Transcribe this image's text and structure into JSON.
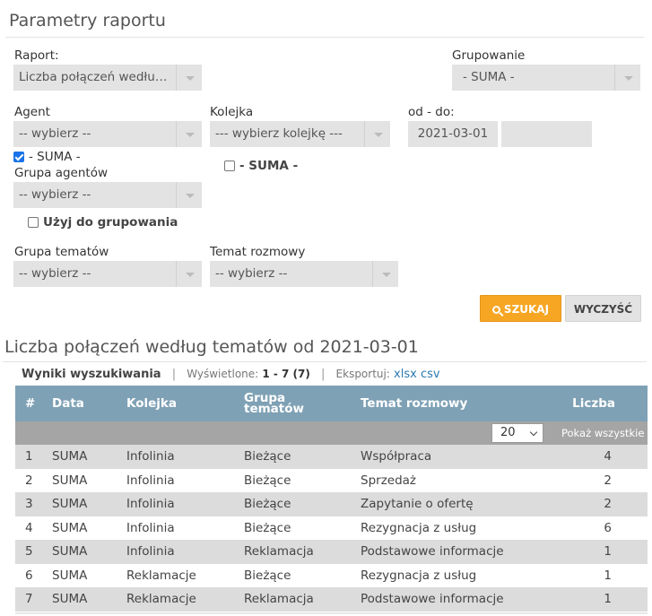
{
  "params": {
    "title": "Parametry raportu",
    "raport_label": "Raport:",
    "raport_value": "Liczba połączeń według tematów",
    "grupowanie_label": "Grupowanie",
    "grupowanie_value": "- SUMA -",
    "agent_label": "Agent",
    "agent_value": "-- wybierz --",
    "kolejka_label": "Kolejka",
    "kolejka_value": "--- wybierz kolejkę ---",
    "od_do_label": "od - do:",
    "date_from": "2021-03-01",
    "date_to": "",
    "agent_suma_label": "- SUMA -",
    "agent_suma_checked": true,
    "kolejka_suma_label": "- SUMA -",
    "kolejka_suma_checked": false,
    "grupa_agentow_label": "Grupa agentów",
    "grupa_agentow_value": "-- wybierz --",
    "uzyj_label": "Użyj do grupowania",
    "uzyj_checked": false,
    "grupa_tematow_label": "Grupa tematów",
    "grupa_tematow_value": "-- wybierz --",
    "temat_label": "Temat rozmowy",
    "temat_value": "-- wybierz --",
    "search_button": "SZUKAJ",
    "clear_button": "WYCZYŚĆ"
  },
  "results": {
    "title": "Liczba połączeń według tematów od 2021-03-01",
    "meta_label": "Wyniki wyszukiwania",
    "displayed_label": "Wyświetlone:",
    "displayed_value": "1 - 7 (7)",
    "export_label": "Eksportuj:",
    "export_xlsx": "xlsx",
    "export_csv": "csv",
    "columns": {
      "num": "#",
      "data": "Data",
      "kolejka": "Kolejka",
      "grupa_line1": "Grupa",
      "grupa_line2": "tematów",
      "temat": "Temat rozmowy",
      "liczba": "Liczba"
    },
    "page_size": "20",
    "show_all": "Pokaż wszystkie",
    "rows": [
      {
        "num": "1",
        "data": "SUMA",
        "kolejka": "Infolinia",
        "grupa": "Bieżące",
        "temat": "Współpraca",
        "liczba": "4"
      },
      {
        "num": "2",
        "data": "SUMA",
        "kolejka": "Infolinia",
        "grupa": "Bieżące",
        "temat": "Sprzedaż",
        "liczba": "2"
      },
      {
        "num": "3",
        "data": "SUMA",
        "kolejka": "Infolinia",
        "grupa": "Bieżące",
        "temat": "Zapytanie o ofertę",
        "liczba": "2"
      },
      {
        "num": "4",
        "data": "SUMA",
        "kolejka": "Infolinia",
        "grupa": "Bieżące",
        "temat": "Rezygnacja z usług",
        "liczba": "6"
      },
      {
        "num": "5",
        "data": "SUMA",
        "kolejka": "Infolinia",
        "grupa": "Reklamacja",
        "temat": "Podstawowe informacje",
        "liczba": "1"
      },
      {
        "num": "6",
        "data": "SUMA",
        "kolejka": "Reklamacje",
        "grupa": "Bieżące",
        "temat": "Rezygnacja z usług",
        "liczba": "1"
      },
      {
        "num": "7",
        "data": "SUMA",
        "kolejka": "Reklamacje",
        "grupa": "Reklamacja",
        "temat": "Podstawowe informacje",
        "liczba": "1"
      }
    ]
  }
}
